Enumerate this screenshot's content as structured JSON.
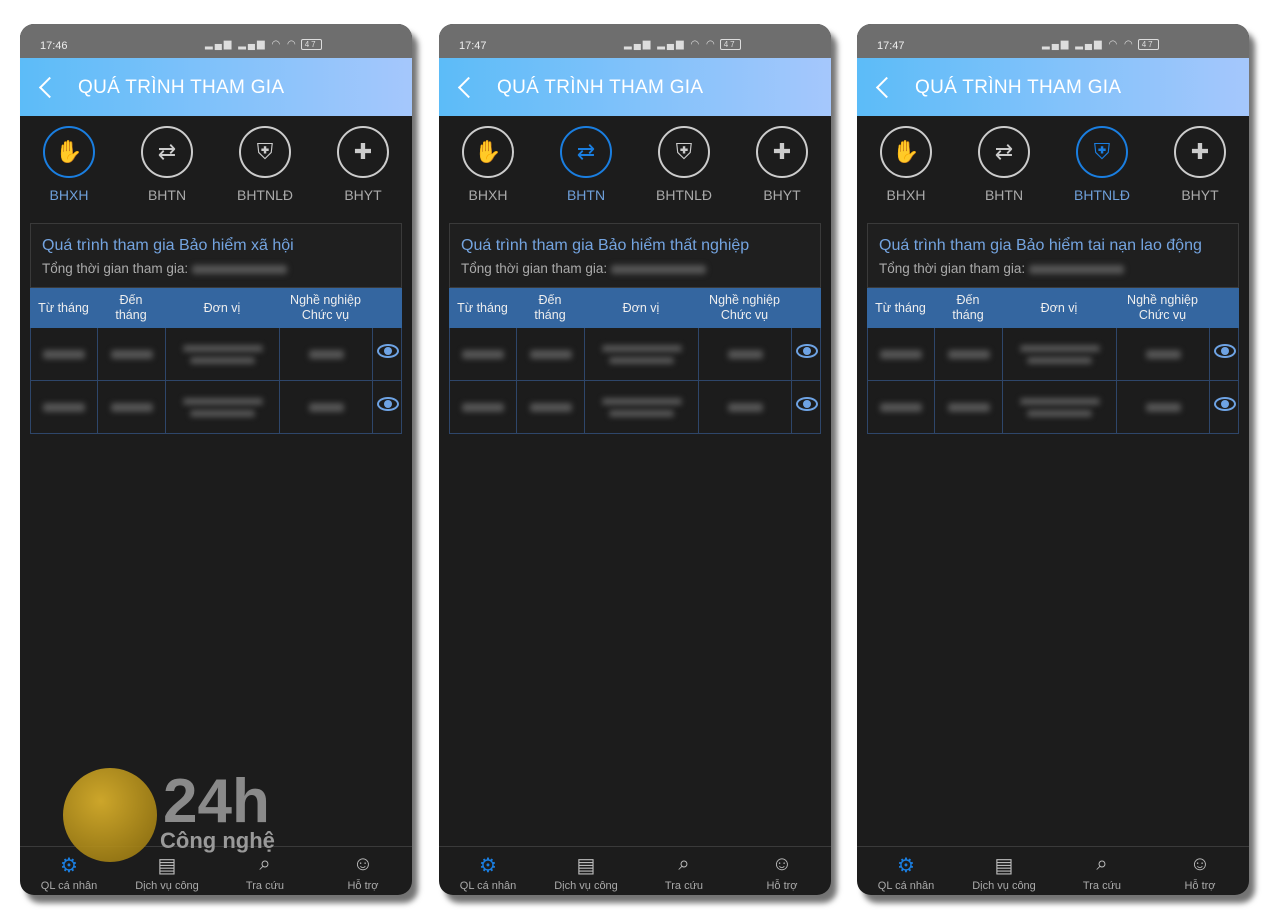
{
  "app_title": "QUÁ TRÌNH THAM GIA",
  "tabs": [
    "BHXH",
    "BHTN",
    "BHTNLĐ",
    "BHYT"
  ],
  "tab_icons": [
    "hands-heart-icon",
    "people-exchange-icon",
    "worker-shield-icon",
    "medical-cross-icon"
  ],
  "table_headers": {
    "from": "Từ tháng",
    "to": "Đến tháng",
    "unit": "Đơn vị",
    "job": "Nghề nghiệp Chức vụ"
  },
  "total_label": "Tổng thời gian tham gia:",
  "nav": [
    {
      "label": "QL cá nhân",
      "icon": "user-gear-icon"
    },
    {
      "label": "Dịch vụ công",
      "icon": "document-icon"
    },
    {
      "label": "Tra cứu",
      "icon": "search-globe-icon"
    },
    {
      "label": "Hỗ trợ",
      "icon": "support-person-icon"
    }
  ],
  "accent_color": "#1a7ee0",
  "header_gradient": [
    "#5cbcf8",
    "#a5c7fc"
  ],
  "table_header_color": "#3466a0",
  "watermark": {
    "number": "24h",
    "text": "Công nghệ"
  },
  "screens": [
    {
      "time": "17:46",
      "battery": "47",
      "active_tab": 0,
      "card_title": "Quá trình tham gia Bảo hiểm xã hội"
    },
    {
      "time": "17:47",
      "battery": "47",
      "active_tab": 1,
      "card_title": "Quá trình tham gia Bảo hiểm thất nghiệp"
    },
    {
      "time": "17:47",
      "battery": "47",
      "active_tab": 2,
      "card_title": "Quá trình tham gia Bảo hiểm tai nạn lao động"
    }
  ]
}
